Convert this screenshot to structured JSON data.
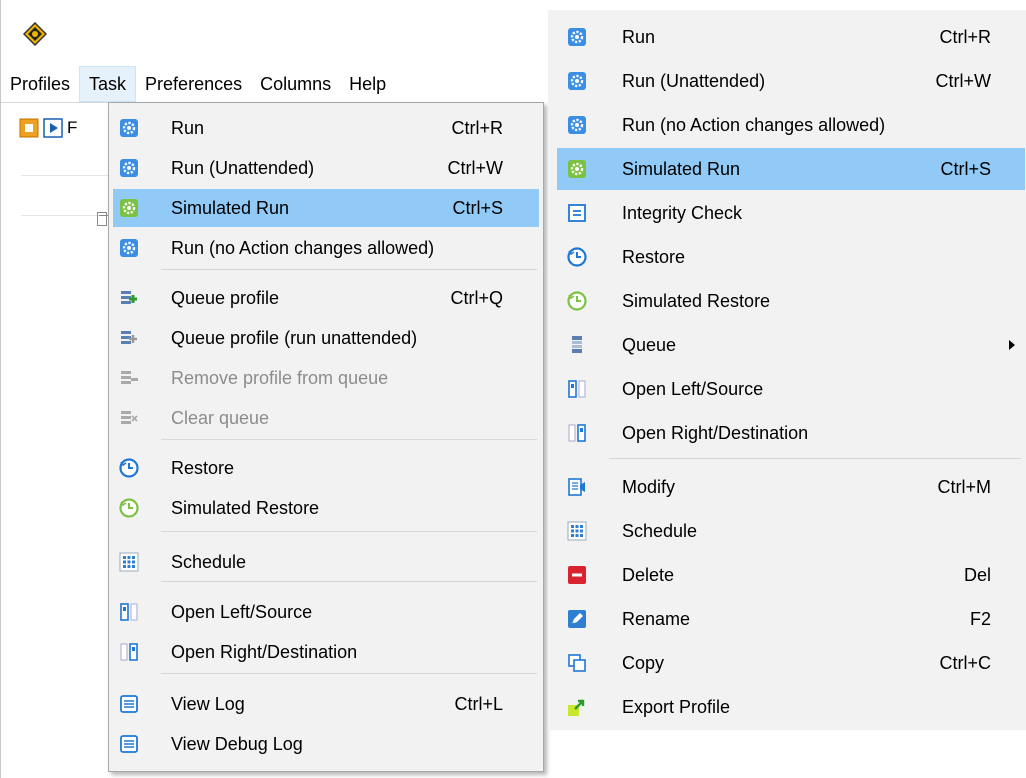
{
  "menubar": {
    "items": [
      {
        "label": "Profiles"
      },
      {
        "label": "Task"
      },
      {
        "label": "Preferences"
      },
      {
        "label": "Columns"
      },
      {
        "label": "Help"
      }
    ]
  },
  "toolbar": {
    "truncated_label": "F"
  },
  "task_menu": {
    "items": [
      {
        "label": "Run",
        "shortcut": "Ctrl+R",
        "icon": "gear-icon"
      },
      {
        "label": "Run (Unattended)",
        "shortcut": "Ctrl+W",
        "icon": "gear-icon"
      },
      {
        "label": "Simulated Run",
        "shortcut": "Ctrl+S",
        "icon": "green-gear-icon",
        "selected": true
      },
      {
        "label": "Run (no Action changes allowed)",
        "shortcut": "",
        "icon": "gear-icon"
      },
      {
        "label": "Queue profile",
        "shortcut": "Ctrl+Q",
        "icon": "queue-add-icon"
      },
      {
        "label": "Queue profile (run unattended)",
        "shortcut": "",
        "icon": "queue-add-outline-icon"
      },
      {
        "label": "Remove profile from queue",
        "shortcut": "",
        "icon": "queue-remove-icon",
        "disabled": true
      },
      {
        "label": "Clear queue",
        "shortcut": "",
        "icon": "queue-clear-icon",
        "disabled": true
      },
      {
        "label": "Restore",
        "shortcut": "",
        "icon": "restore-clock-icon"
      },
      {
        "label": "Simulated Restore",
        "shortcut": "",
        "icon": "simulated-restore-clock-icon"
      },
      {
        "label": "Schedule",
        "shortcut": "",
        "icon": "schedule-grid-icon"
      },
      {
        "label": "Open Left/Source",
        "shortcut": "",
        "icon": "open-left-icon"
      },
      {
        "label": "Open Right/Destination",
        "shortcut": "",
        "icon": "open-right-icon"
      },
      {
        "label": "View Log",
        "shortcut": "Ctrl+L",
        "icon": "log-icon"
      },
      {
        "label": "View Debug Log",
        "shortcut": "",
        "icon": "debug-log-icon"
      }
    ]
  },
  "context_menu": {
    "items": [
      {
        "label": "Run",
        "shortcut": "Ctrl+R",
        "icon": "gear-icon"
      },
      {
        "label": "Run (Unattended)",
        "shortcut": "Ctrl+W",
        "icon": "gear-icon"
      },
      {
        "label": "Run (no Action changes allowed)",
        "shortcut": "",
        "icon": "gear-icon"
      },
      {
        "label": "Simulated Run",
        "shortcut": "Ctrl+S",
        "icon": "green-gear-icon",
        "selected": true
      },
      {
        "label": "Integrity Check",
        "shortcut": "",
        "icon": "integrity-check-icon"
      },
      {
        "label": "Restore",
        "shortcut": "",
        "icon": "restore-clock-icon"
      },
      {
        "label": "Simulated Restore",
        "shortcut": "",
        "icon": "simulated-restore-clock-icon"
      },
      {
        "label": "Queue",
        "shortcut": "",
        "icon": "queue-icon",
        "submenu": true
      },
      {
        "label": "Open Left/Source",
        "shortcut": "",
        "icon": "open-left-icon"
      },
      {
        "label": "Open Right/Destination",
        "shortcut": "",
        "icon": "open-right-icon"
      },
      {
        "label": "Modify",
        "shortcut": "Ctrl+M",
        "icon": "modify-icon"
      },
      {
        "label": "Schedule",
        "shortcut": "",
        "icon": "schedule-grid-icon"
      },
      {
        "label": "Delete",
        "shortcut": "Del",
        "icon": "delete-icon"
      },
      {
        "label": "Rename",
        "shortcut": "F2",
        "icon": "rename-pencil-icon"
      },
      {
        "label": "Copy",
        "shortcut": "Ctrl+C",
        "icon": "copy-icon"
      },
      {
        "label": "Export Profile",
        "shortcut": "",
        "icon": "export-icon"
      }
    ]
  },
  "colors": {
    "selection": "#91c9f7",
    "menu_background": "#f2f2f2",
    "gear_blue": "#3a8ee6",
    "gear_green": "#7cc242",
    "disabled_text": "#8c8c8c"
  }
}
